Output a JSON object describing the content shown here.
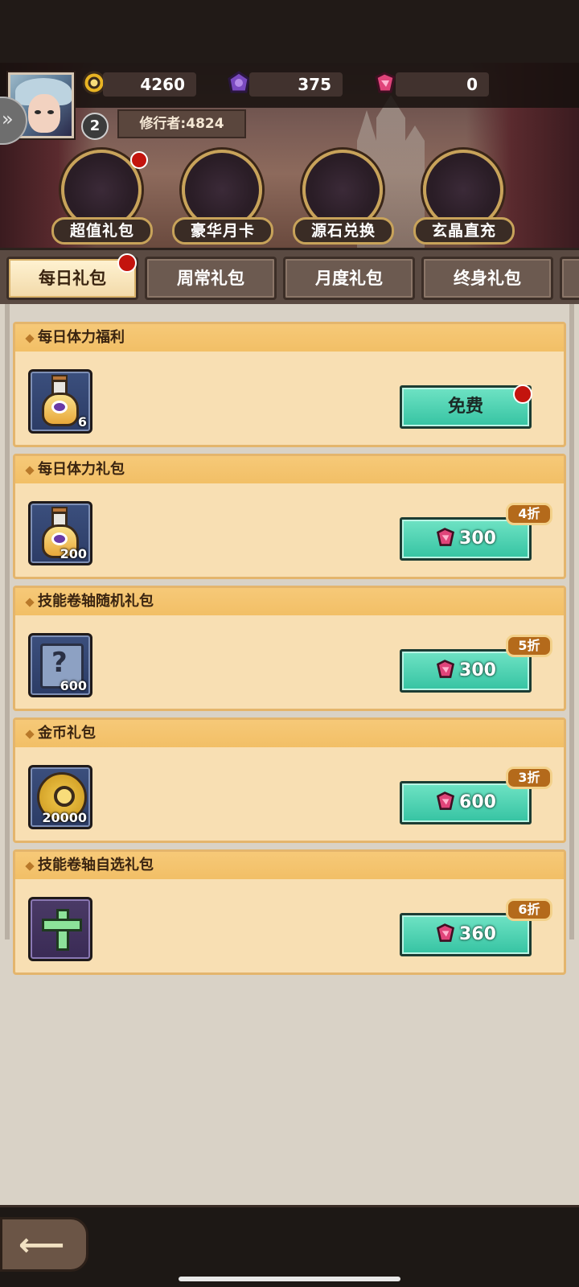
{
  "header": {
    "currencies": [
      {
        "icon": "gold-coin-icon",
        "value": "4260"
      },
      {
        "icon": "purple-source-stone-icon",
        "value": "375"
      },
      {
        "icon": "pink-crystal-icon",
        "value": "0"
      }
    ],
    "player_level": "2",
    "player_name": "修行者:4824",
    "promos": [
      {
        "label": "超值礼包",
        "has_dot": true
      },
      {
        "label": "豪华月卡",
        "has_dot": false
      },
      {
        "label": "源石兑换",
        "has_dot": false
      },
      {
        "label": "玄晶直充",
        "has_dot": false
      }
    ]
  },
  "tabs": [
    {
      "label": "每日礼包",
      "active": true,
      "has_dot": true
    },
    {
      "label": "周常礼包",
      "active": false
    },
    {
      "label": "月度礼包",
      "active": false
    },
    {
      "label": "终身礼包",
      "active": false
    }
  ],
  "packs": [
    {
      "title": "每日体力福利",
      "item": "stamina-potion-icon",
      "qty": "6",
      "button": "免费",
      "has_dot": true
    },
    {
      "title": "每日体力礼包",
      "item": "stamina-potion-icon",
      "qty": "200",
      "price": "300",
      "discount": "4折"
    },
    {
      "title": "技能卷轴随机礼包",
      "item": "skill-scroll-icon",
      "qty": "600",
      "price": "300",
      "discount": "5折"
    },
    {
      "title": "金币礼包",
      "item": "gold-coin-icon",
      "qty": "20000",
      "price": "600",
      "discount": "3折"
    },
    {
      "title": "技能卷轴自选礼包",
      "item": "green-skill-icon",
      "qty": "",
      "price": "360",
      "discount": "6折"
    }
  ],
  "colors": {
    "accent_green": "#35c3a2",
    "card_bg": "#f8dfb3",
    "card_header": "#f2bf66",
    "notify_red": "#c3140e"
  }
}
